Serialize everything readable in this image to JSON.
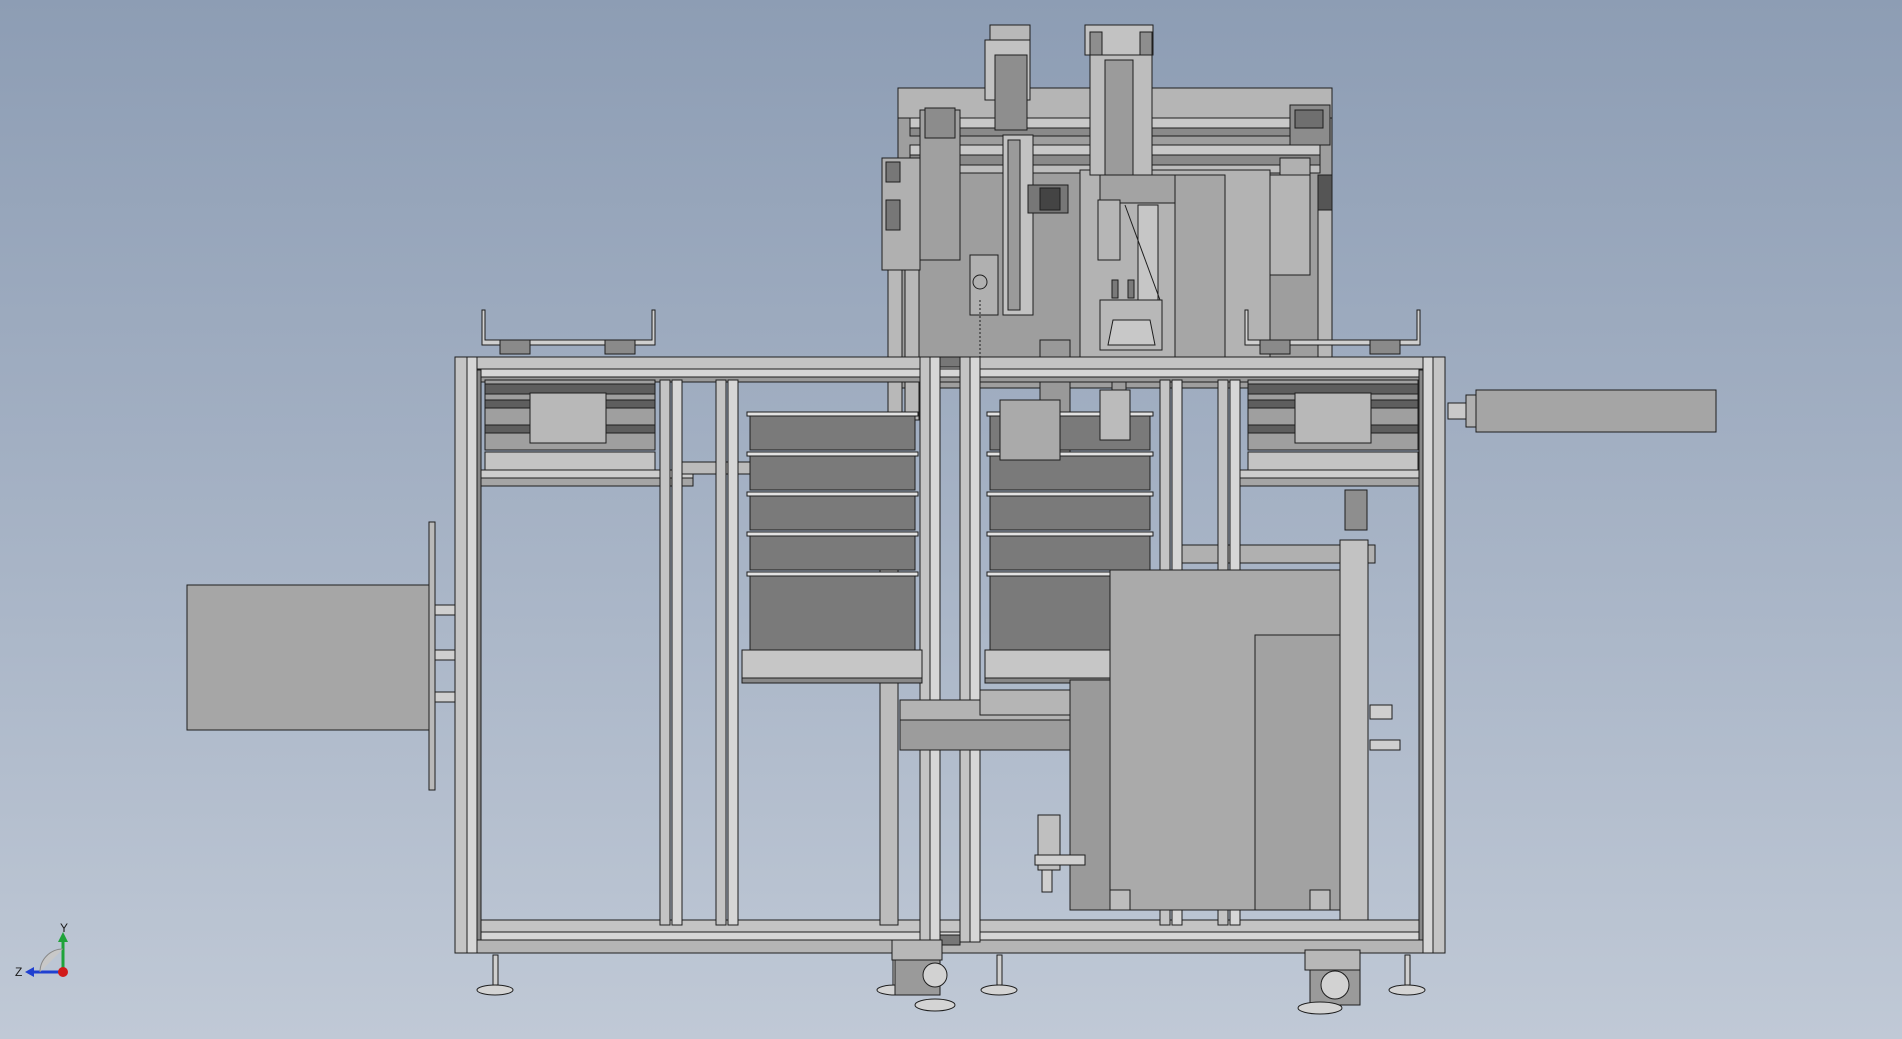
{
  "viewport": {
    "background_top": "#8d9db4",
    "background_bottom": "#c0c9d6",
    "part_fill": "#a9a9a9",
    "part_stroke": "#1e1e1e",
    "frame_fill": "#c4c4c4",
    "dark_fill": "#6f6f6f"
  },
  "triad": {
    "y_label": "Y",
    "z_label": "Z",
    "y_color": "#1fa33a",
    "z_color": "#2040d0",
    "origin_color": "#d11a1a"
  }
}
